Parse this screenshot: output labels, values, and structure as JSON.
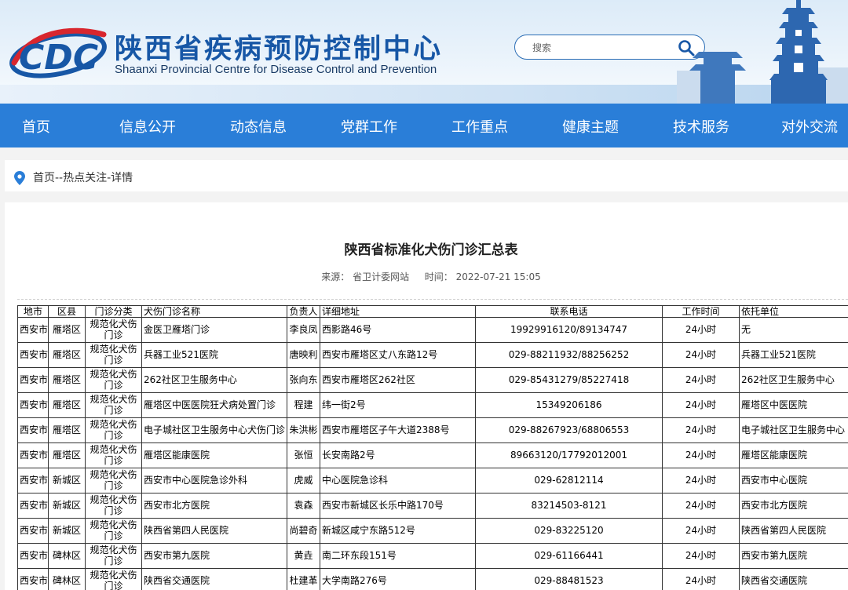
{
  "header": {
    "logo_letters": "CDC",
    "title": "陕西省疾病预防控制中心",
    "subtitle": "Shaanxi Provincial Centre for Disease Control and Prevention",
    "search_placeholder": "搜索",
    "colors": {
      "brand_blue": "#1757a6",
      "nav_blue": "#2a7ed8",
      "logo_red": "#d8262e"
    }
  },
  "nav": [
    "首页",
    "信息公开",
    "动态信息",
    "党群工作",
    "工作重点",
    "健康主题",
    "技术服务",
    "对外交流"
  ],
  "breadcrumb": "首页--热点关注-详情",
  "article": {
    "title": "陕西省标准化犬伤门诊汇总表",
    "source_label": "来源：",
    "source": "省卫计委网站",
    "time_label": "时间：",
    "time": "2022-07-21 15:05"
  },
  "table": {
    "headers": [
      "地市",
      "区县",
      "门诊分类",
      "犬伤门诊名称",
      "负责人",
      "详细地址",
      "联系电话",
      "工作时间",
      "依托单位"
    ],
    "rows": [
      [
        "西安市",
        "雁塔区",
        "规范化犬伤门诊",
        "金医卫雁塔门诊",
        "李良凤",
        "西影路46号",
        "19929916120/89134747",
        "24小时",
        "无"
      ],
      [
        "西安市",
        "雁塔区",
        "规范化犬伤门诊",
        "兵器工业521医院",
        "唐映利",
        "西安市雁塔区丈八东路12号",
        "029-88211932/88256252",
        "24小时",
        "兵器工业521医院"
      ],
      [
        "西安市",
        "雁塔区",
        "规范化犬伤门诊",
        "262社区卫生服务中心",
        "张向东",
        "西安市雁塔区262社区",
        "029-85431279/85227418",
        "24小时",
        "262社区卫生服务中心"
      ],
      [
        "西安市",
        "雁塔区",
        "规范化犬伤门诊",
        "雁塔区中医医院狂犬病处置门诊",
        "程建",
        "纬一街2号",
        "15349206186",
        "24小时",
        "雁塔区中医医院"
      ],
      [
        "西安市",
        "雁塔区",
        "规范化犬伤门诊",
        "电子城社区卫生服务中心犬伤门诊",
        "朱洪彬",
        "西安市雁塔区子午大道2388号",
        "029-88267923/68806553",
        "24小时",
        "电子城社区卫生服务中心"
      ],
      [
        "西安市",
        "雁塔区",
        "规范化犬伤门诊",
        "雁塔区能康医院",
        "张恒",
        "长安南路2号",
        "89663120/17792012001",
        "24小时",
        "雁塔区能康医院"
      ],
      [
        "西安市",
        "新城区",
        "规范化犬伤门诊",
        "西安市中心医院急诊外科",
        "虎威",
        "中心医院急诊科",
        "029-62812114",
        "24小时",
        "西安市中心医院"
      ],
      [
        "西安市",
        "新城区",
        "规范化犬伤门诊",
        "西安市北方医院",
        "袁森",
        "西安市新城区长乐中路170号",
        "83214503-8121",
        "24小时",
        "西安市北方医院"
      ],
      [
        "西安市",
        "新城区",
        "规范化犬伤门诊",
        "陕西省第四人民医院",
        "尚碧奇",
        "新城区咸宁东路512号",
        "029-83225120",
        "24小时",
        "陕西省第四人民医院"
      ],
      [
        "西安市",
        "碑林区",
        "规范化犬伤门诊",
        "西安市第九医院",
        "黄垚",
        "南二环东段151号",
        "029-61166441",
        "24小时",
        "西安市第九医院"
      ],
      [
        "西安市",
        "碑林区",
        "规范化犬伤门诊",
        "陕西省交通医院",
        "杜建革",
        "大学南路276号",
        "029-88481523",
        "24小时",
        "陕西省交通医院"
      ]
    ]
  }
}
